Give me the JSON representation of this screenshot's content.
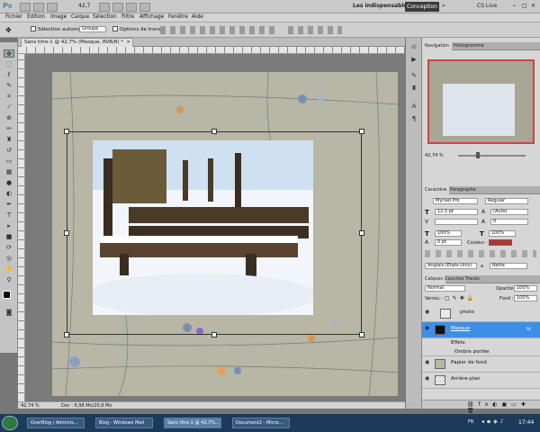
{
  "app": {
    "logo": "Ps",
    "zoom": "42,7",
    "workspace": "Les indispensables",
    "workspace_active": "Conception",
    "cs_live": "CS Live"
  },
  "menu": [
    "Fichier",
    "Edition",
    "Image",
    "Calque",
    "Sélection",
    "Filtre",
    "Affichage",
    "Fenêtre",
    "Aide"
  ],
  "options": {
    "auto_select_label": "Sélection automatique :",
    "auto_select_value": "Groupe",
    "transform_label": "Options de transf."
  },
  "document": {
    "tab_title": "Sans titre-1 @ 42,7% (Masque, RVB/8) *",
    "status_zoom": "42,74 %",
    "status_doc": "Doc : 6,98 Mo/20,9 Mo"
  },
  "navigator": {
    "tabs": [
      "Navigation",
      "Histogramme"
    ],
    "zoom": "42,74 %"
  },
  "character": {
    "tabs": [
      "Caractère",
      "Paragraphe"
    ],
    "font": "Myriad Pro",
    "style": "Regular",
    "size": "12,5 pt",
    "leading": "(Auto)",
    "tracking": "0",
    "vscale": "100%",
    "hscale": "100%",
    "baseline": "0 pt",
    "color_label": "Couleur :",
    "language": "Anglais (Etats-Unis)",
    "aa_prefix": "a",
    "antialias": "Nette"
  },
  "layers": {
    "tabs": [
      "Calques",
      "Couches",
      "Tracés"
    ],
    "blend": "Normal",
    "opacity_label": "Opacité :",
    "opacity": "100%",
    "lock_label": "Verrou :",
    "fill_label": "Fond :",
    "fill": "100%",
    "items": [
      {
        "name": "photo"
      },
      {
        "name": "Masque"
      },
      {
        "name": "Effets"
      },
      {
        "name": "Ombre portée"
      },
      {
        "name": "Papier de fond"
      },
      {
        "name": "Arrière-plan"
      }
    ]
  },
  "taskbar": {
    "items": [
      "OverBlog / Adminis...",
      "Blog - Windows Mail",
      "Sans titre-1 @ 42,7%...",
      "Document2 - Micro..."
    ],
    "lang": "FR",
    "clock": "17:44"
  },
  "colors": {
    "accent": "#3d8fe6",
    "text_color_swatch": "#b83232",
    "taskbar": "#1c3a5a"
  }
}
